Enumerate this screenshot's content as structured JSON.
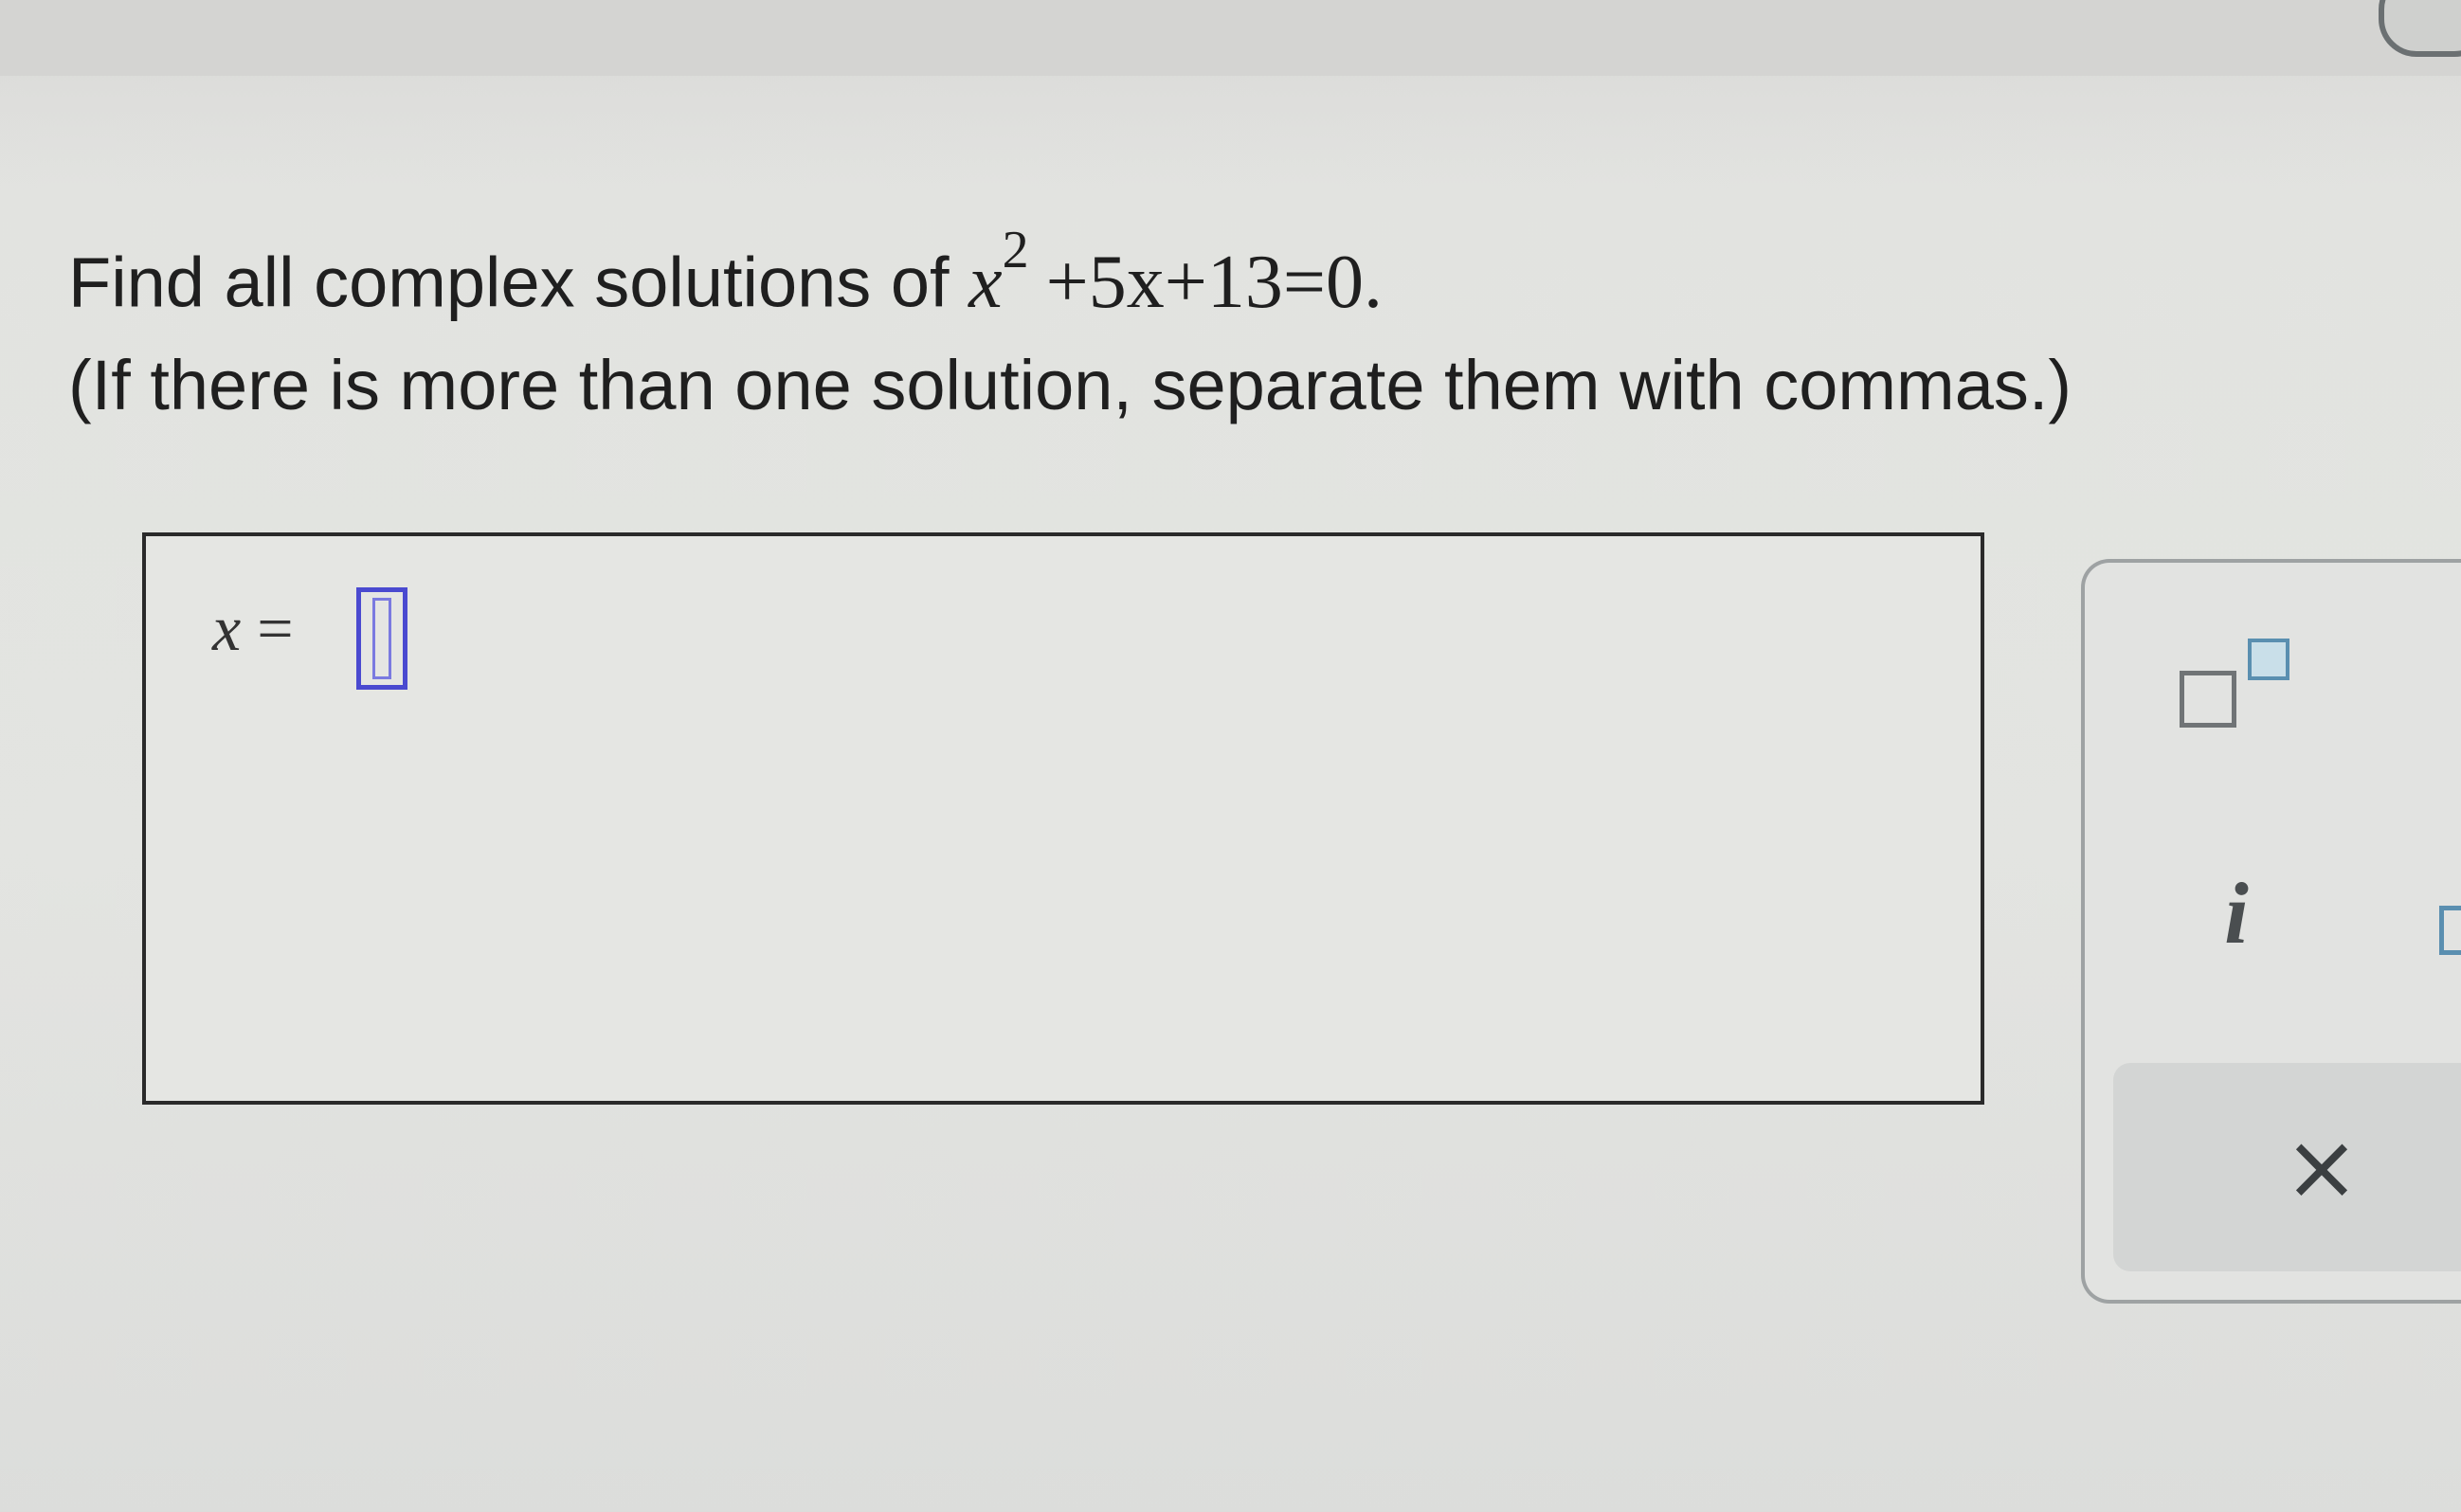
{
  "question": {
    "line1_text": "Find all complex solutions of ",
    "equation": {
      "var": "x",
      "exponent": "2",
      "rest": "+5x+13=0."
    },
    "line2_text": "(If there is more than one solution, separate them with commas.)"
  },
  "answer": {
    "label_var": "x",
    "label_eq": " = ",
    "value": ""
  },
  "keypad": {
    "keys": {
      "exponent_icon": "superscript-template-icon",
      "i_label": "i",
      "clear_label": "×"
    }
  }
}
